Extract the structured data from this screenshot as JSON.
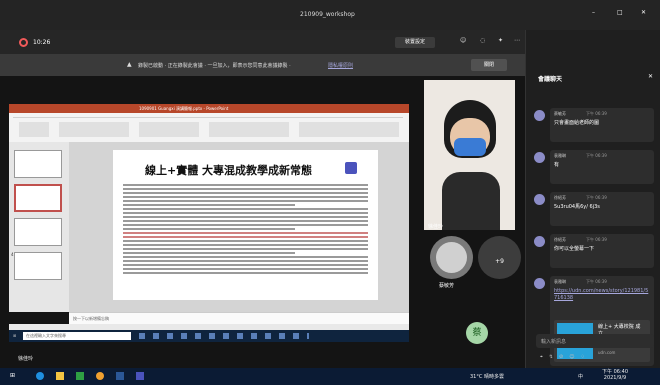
{
  "window": {
    "title": "210909_workshop",
    "min": "–",
    "max": "□",
    "close": "✕"
  },
  "topbar": {
    "timer": "10:26",
    "device_settings": "裝置設定",
    "leave": "離開"
  },
  "banner": {
    "text": "錄製已啟動 · 正在錄製此會議 · 一旦加入，即表示您同意此會議錄製 ·",
    "link": "隱私權原則",
    "dismiss": "關閉"
  },
  "ppt": {
    "window_title": "1090901 Guangxi 演講簡報.pptx - PowerPoint",
    "slide_title": "線上+實體 大專混成教學成新常態",
    "notes_placeholder": "按一下以新增備忘稿",
    "slide_num": "4",
    "search_placeholder": "在這裡輸入文字來搜尋",
    "slide_text_lines": 23
  },
  "participants": {
    "main_name": "徐佳玲",
    "tile1_name": "蔡敏芳",
    "overflow": "+9",
    "avatar_char": "蔡"
  },
  "chat": {
    "header": "會議聊天",
    "messages": [
      {
        "name": "蔡敏芳",
        "time": "下午 06:39",
        "text": "只會畫面給老師的圖"
      },
      {
        "name": "袁雅琳",
        "time": "下午 06:39",
        "text": "有"
      },
      {
        "name": "徐紹芳",
        "time": "下午 06:39",
        "text": "5u3ru04馬6y/ 6j3s"
      },
      {
        "name": "徐紹芳",
        "time": "下午 06:39",
        "text": "你可以全螢幕一下"
      },
      {
        "name": "袁雅琳",
        "time": "下午 06:39",
        "text": "https://udn.com/news/story/121981/5716138"
      }
    ],
    "link_card_title": "線上+ 大專校院 成立...",
    "link_card_domain": "udn.com",
    "input_placeholder": "輸入新訊息"
  },
  "taskbar": {
    "weather": "31°C 晴時多雲",
    "lang": "中",
    "time": "下午 06:40",
    "date": "2021/9/9"
  },
  "colors": {
    "accent": "#6264a7",
    "leave": "#c4314b",
    "ppt": "#b7472a"
  }
}
